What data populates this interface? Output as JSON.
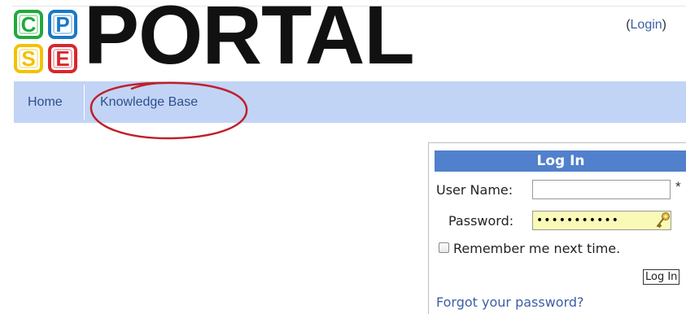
{
  "logo": {
    "tiles": [
      {
        "letter": "C",
        "color": "#1faa3c"
      },
      {
        "letter": "P",
        "color": "#1a78c8"
      },
      {
        "letter": "S",
        "color": "#f2c200"
      },
      {
        "letter": "E",
        "color": "#d8262f"
      }
    ],
    "wordmark": "PORTAL"
  },
  "header": {
    "login_link_prefix": "(",
    "login_link": "Login",
    "login_link_suffix": ")"
  },
  "nav": {
    "home": "Home",
    "knowledge_base": "Knowledge Base"
  },
  "annotation": {
    "color": "#c0202a"
  },
  "login_panel": {
    "title": "Log In",
    "username_label": "User Name:",
    "username_value": "",
    "required_marker": "*",
    "password_label": "Password:",
    "password_value": "•••••••••••",
    "remember_label": "Remember me next time.",
    "remember_checked": false,
    "submit_label": "Log In",
    "forgot_link": "Forgot your password?"
  }
}
